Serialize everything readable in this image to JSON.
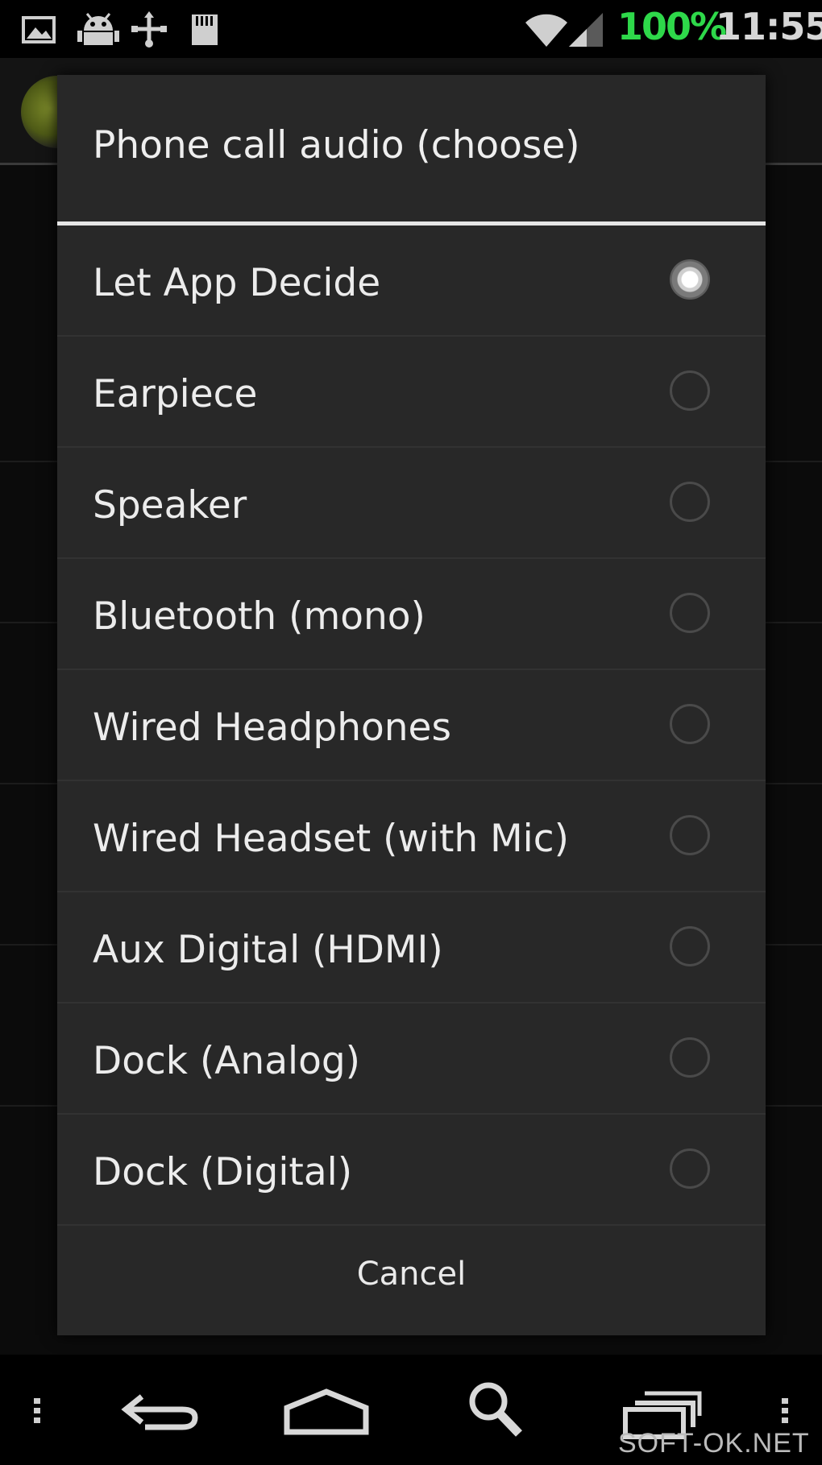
{
  "status_bar": {
    "icons": [
      "picture-icon",
      "android-debug-icon",
      "usb-icon",
      "sd-card-icon",
      "wifi-icon",
      "cell-signal-icon"
    ],
    "battery": "100%",
    "time": "11:55",
    "battery_color": "#2ed84a"
  },
  "dialog": {
    "title": "Phone call audio (choose)",
    "options": [
      {
        "label": "Let App Decide",
        "selected": true
      },
      {
        "label": "Earpiece",
        "selected": false
      },
      {
        "label": "Speaker",
        "selected": false
      },
      {
        "label": "Bluetooth (mono)",
        "selected": false
      },
      {
        "label": "Wired Headphones",
        "selected": false
      },
      {
        "label": "Wired Headset (with Mic)",
        "selected": false
      },
      {
        "label": "Aux Digital (HDMI)",
        "selected": false
      },
      {
        "label": "Dock (Analog)",
        "selected": false
      },
      {
        "label": "Dock (Digital)",
        "selected": false
      }
    ],
    "cancel_label": "Cancel"
  },
  "nav_bar": {
    "icons": [
      "overflow-menu-icon",
      "back-icon",
      "home-icon",
      "search-icon",
      "recent-apps-icon",
      "overflow-menu-icon"
    ]
  },
  "watermark": "SOFT-OK.NET"
}
